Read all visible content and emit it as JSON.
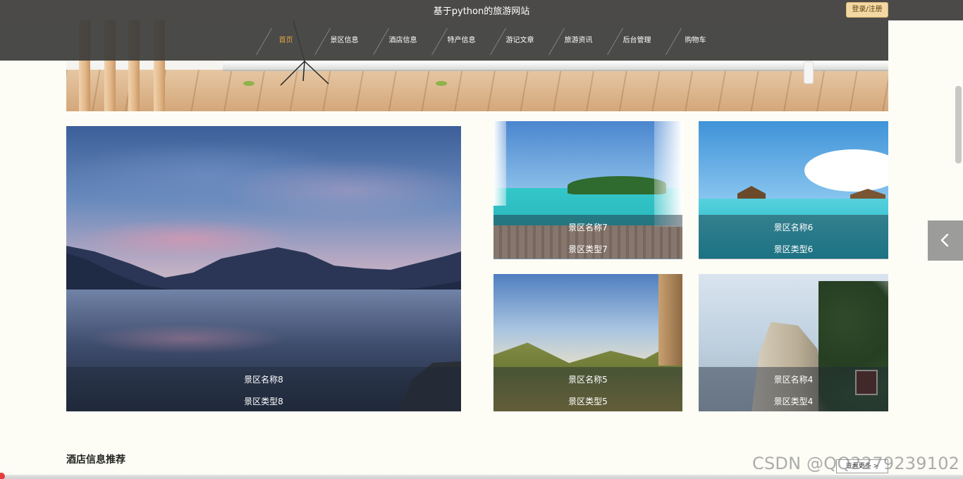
{
  "header": {
    "site_title": "基于python的旅游网站",
    "login_label": "登录/注册"
  },
  "nav": {
    "items": [
      {
        "label": "首页",
        "active": true
      },
      {
        "label": "景区信息",
        "active": false
      },
      {
        "label": "酒店信息",
        "active": false
      },
      {
        "label": "特产信息",
        "active": false
      },
      {
        "label": "游记文章",
        "active": false
      },
      {
        "label": "旅游资讯",
        "active": false
      },
      {
        "label": "后台管理",
        "active": false
      },
      {
        "label": "购物车",
        "active": false
      }
    ],
    "active_color": "#e5a546"
  },
  "featured": {
    "main": {
      "name": "景区名称8",
      "type": "景区类型8"
    },
    "cards": [
      {
        "name": "景区名称7",
        "type": "景区类型7"
      },
      {
        "name": "景区名称6",
        "type": "景区类型6"
      },
      {
        "name": "景区名称5",
        "type": "景区类型5"
      },
      {
        "name": "景区名称4",
        "type": "景区类型4"
      }
    ]
  },
  "side_arrow_icon": "chevron-left-icon",
  "hotel_section": {
    "title": "酒店信息推荐",
    "more_label": "查看更多 >"
  },
  "watermark": "CSDN @QQ2279239102",
  "colors": {
    "header_bg": "#4b4a48",
    "login_bg": "#f4d8a3",
    "page_bg": "#fdfdf6"
  }
}
